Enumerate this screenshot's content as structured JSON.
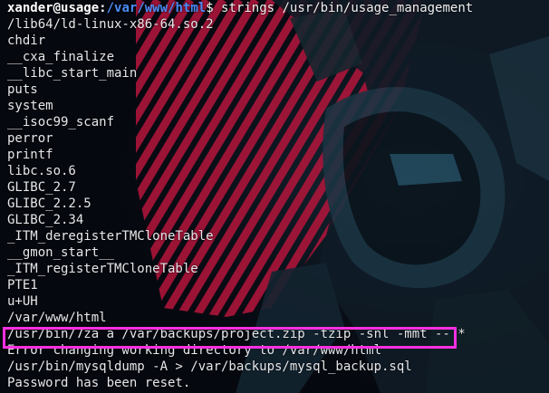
{
  "prompt": {
    "user": "xander",
    "at": "@",
    "host": "usage",
    "sep": ":",
    "path": "/var/www/html",
    "dollar": "$",
    "command": " strings /usr/bin/usage_management"
  },
  "output_lines": [
    "/lib64/ld-linux-x86-64.so.2",
    "chdir",
    "__cxa_finalize",
    "__libc_start_main",
    "puts",
    "system",
    "__isoc99_scanf",
    "perror",
    "printf",
    "libc.so.6",
    "GLIBC_2.7",
    "GLIBC_2.2.5",
    "GLIBC_2.34",
    "_ITM_deregisterTMCloneTable",
    "__gmon_start__",
    "_ITM_registerTMCloneTable",
    "PTE1",
    "u+UH",
    "/var/www/html",
    "/usr/bin/7za a /var/backups/project.zip -tzip -snl -mmt -- *",
    "Error changing working directory to /var/www/html",
    "/usr/bin/mysqldump -A > /var/backups/mysql_backup.sql",
    "Password has been reset."
  ],
  "colors": {
    "highlight": "#ff2fe0",
    "path": "#4a8cf7",
    "stripes": "#b5163d"
  }
}
